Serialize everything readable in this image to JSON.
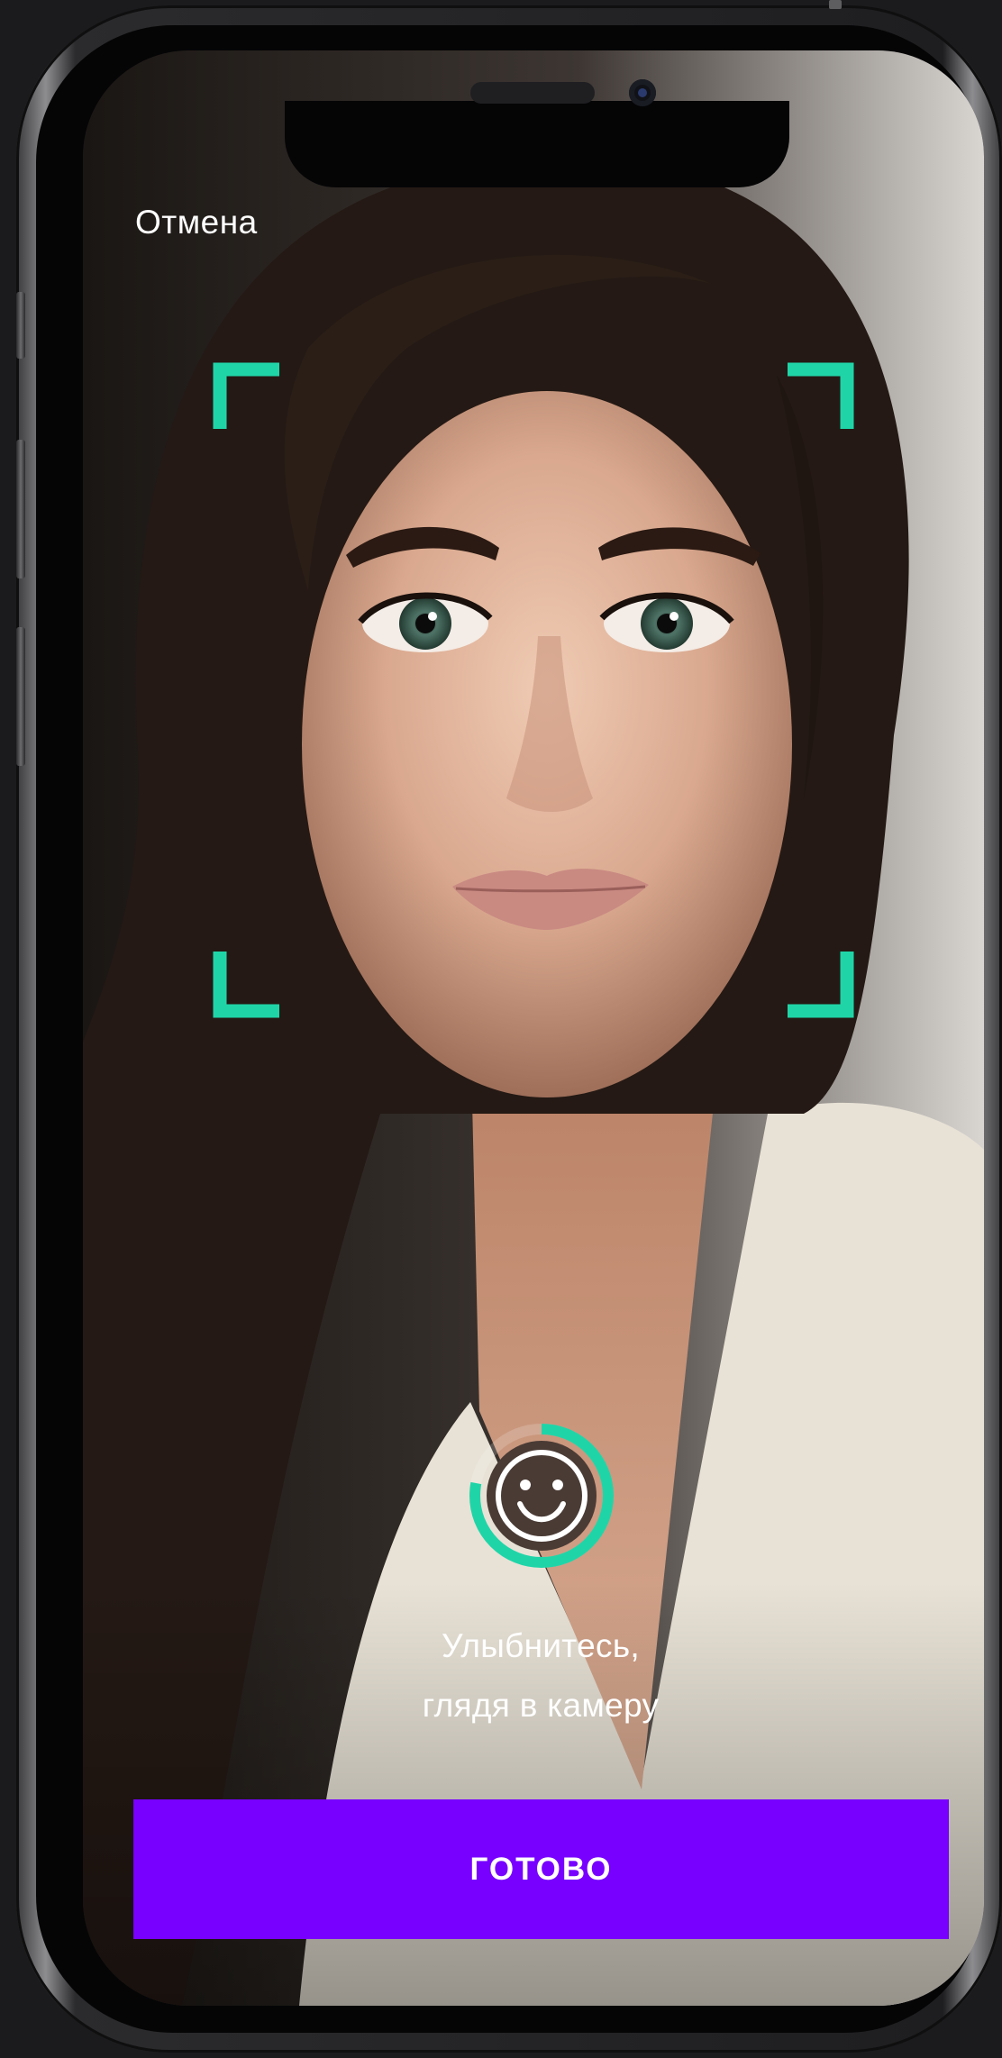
{
  "header": {
    "cancel_label": "Отмена"
  },
  "scan": {
    "frame_color": "#1fd5a8",
    "progress_color": "#1fd5a8",
    "smile_progress": 0.78,
    "indicator_icon": "smile-face-icon"
  },
  "prompt": {
    "line1": "Улыбнитесь,",
    "line2": "глядя в камеру"
  },
  "footer": {
    "done_label": "ГОТОВО",
    "accent": "#7700ff"
  }
}
